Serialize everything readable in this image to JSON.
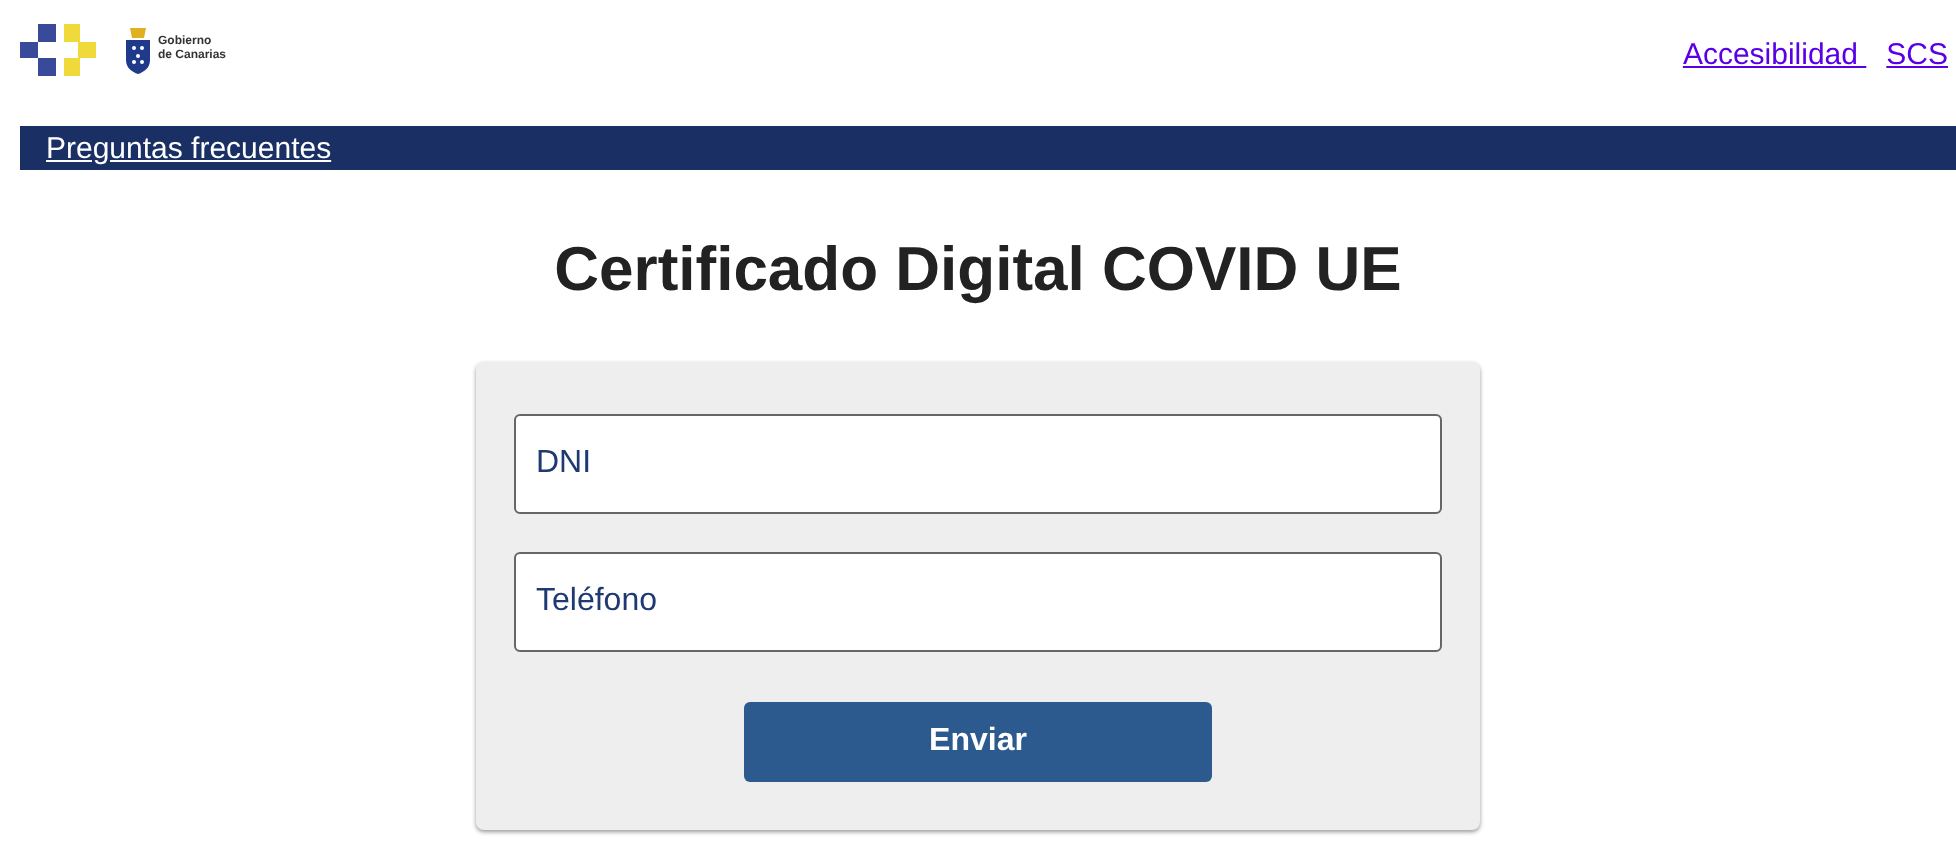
{
  "header": {
    "logo_text": [
      "Gobierno",
      "de Canarias"
    ],
    "links": [
      "Accesibilidad ",
      "SCS"
    ]
  },
  "nav": {
    "links": [
      "Preguntas frecuentes"
    ]
  },
  "title": "Certificado Digital COVID UE",
  "form": {
    "fields": [
      {
        "placeholder": "DNI"
      },
      {
        "placeholder": "Teléfono"
      }
    ],
    "submit": "Enviar"
  }
}
